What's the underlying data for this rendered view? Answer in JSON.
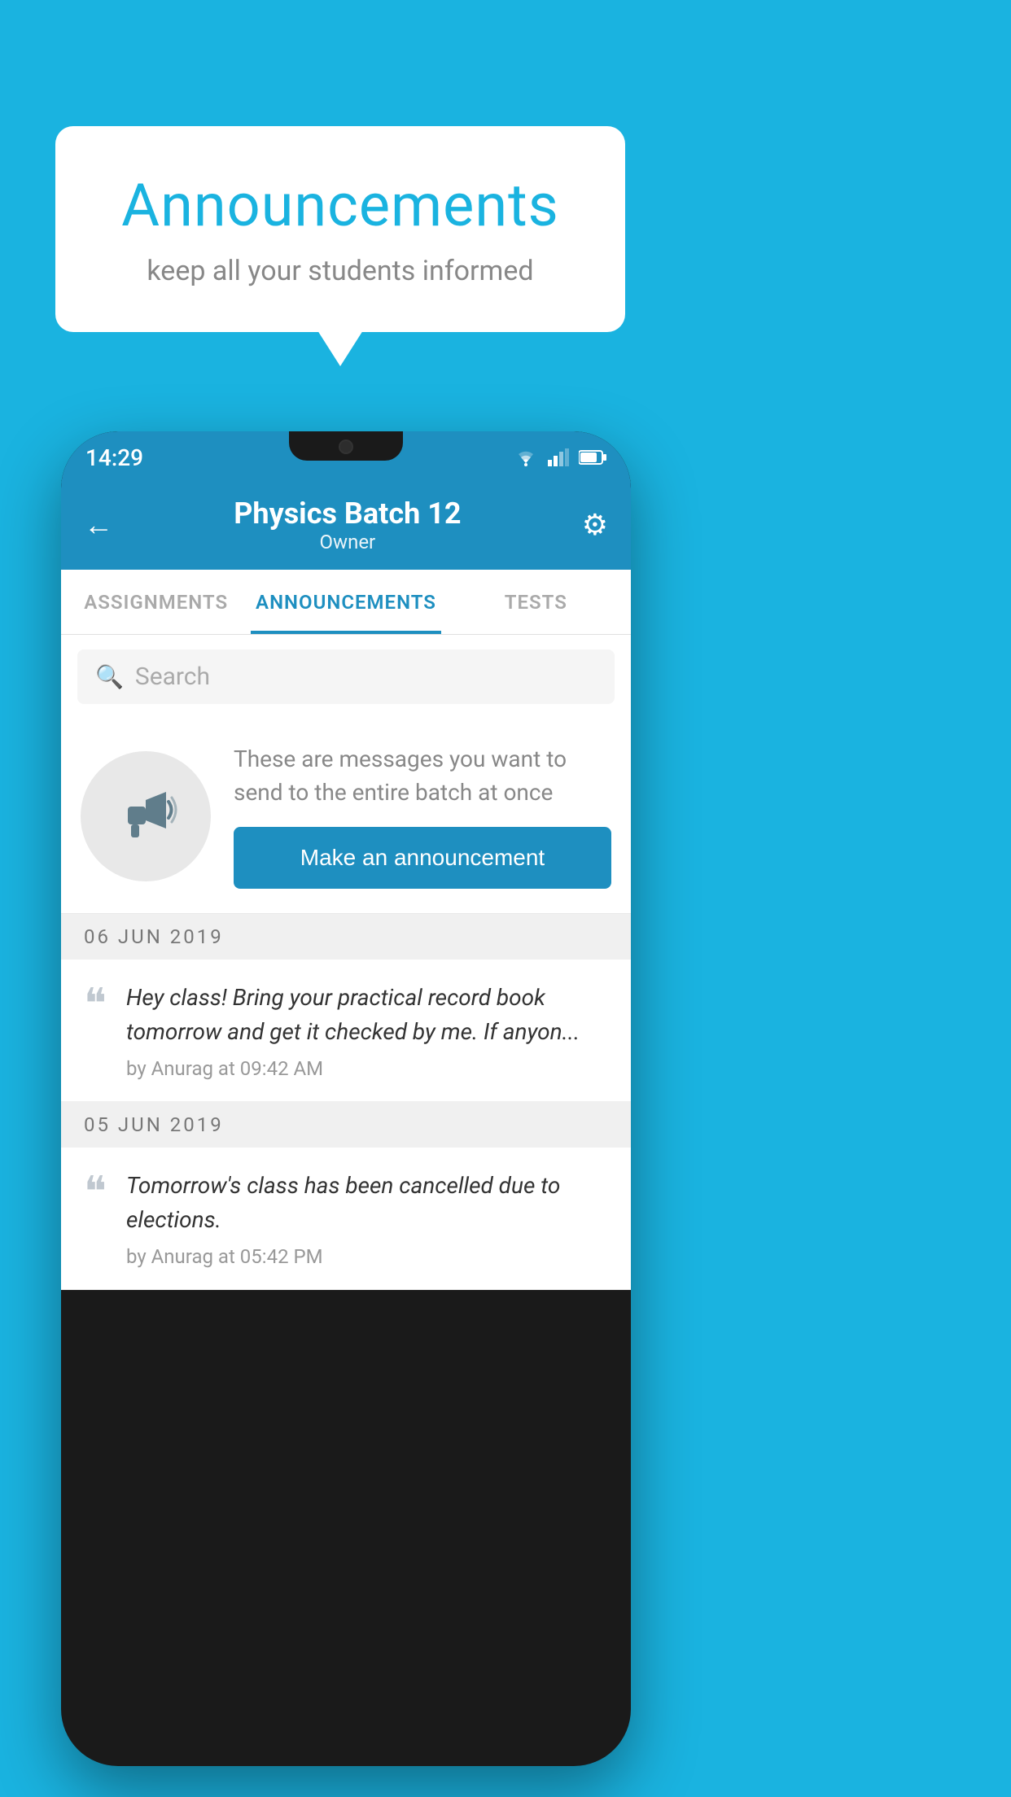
{
  "background_color": "#1ab3e0",
  "speech_bubble": {
    "title": "Announcements",
    "subtitle": "keep all your students informed"
  },
  "phone": {
    "status_bar": {
      "time": "14:29"
    },
    "header": {
      "title": "Physics Batch 12",
      "subtitle": "Owner",
      "back_label": "←",
      "gear_label": "⚙"
    },
    "tabs": [
      {
        "label": "ASSIGNMENTS",
        "active": false
      },
      {
        "label": "ANNOUNCEMENTS",
        "active": true
      },
      {
        "label": "TESTS",
        "active": false
      }
    ],
    "search": {
      "placeholder": "Search"
    },
    "promo": {
      "description": "These are messages you want to send to the entire batch at once",
      "button_label": "Make an announcement"
    },
    "announcements": [
      {
        "date": "06  JUN  2019",
        "text": "Hey class! Bring your practical record book tomorrow and get it checked by me. If anyon...",
        "meta": "by Anurag at 09:42 AM"
      },
      {
        "date": "05  JUN  2019",
        "text": "Tomorrow's class has been cancelled due to elections.",
        "meta": "by Anurag at 05:42 PM"
      }
    ]
  }
}
